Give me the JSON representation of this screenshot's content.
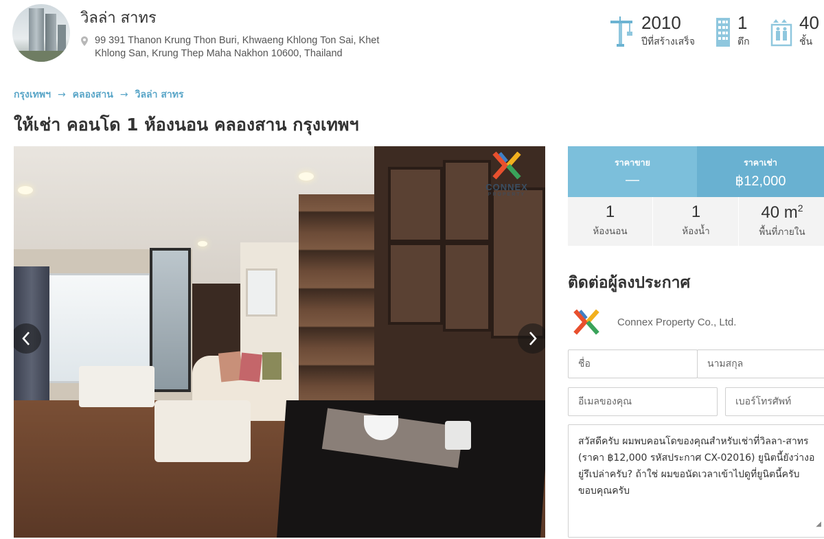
{
  "project": {
    "name": "วิลล่า สาทร",
    "address": "99 391 Thanon Krung Thon Buri, Khwaeng Khlong Ton Sai, Khet Khlong San, Krung Thep Maha Nakhon 10600, Thailand"
  },
  "stats": {
    "year_built": {
      "value": "2010",
      "label": "ปีที่สร้างเสร็จ",
      "icon": "crane-icon"
    },
    "buildings": {
      "value": "1",
      "label": "ตึก",
      "icon": "building-icon"
    },
    "floors": {
      "value": "40",
      "label": "ชั้น",
      "icon": "elevator-icon"
    }
  },
  "breadcrumb": {
    "items": [
      "กรุงเทพฯ",
      "คลองสาน",
      "วิลล่า สาทร"
    ],
    "separator": "→"
  },
  "page_title": "ให้เช่า คอนโด 1 ห้องนอน คลองสาน กรุงเทพฯ",
  "gallery": {
    "watermark_text": "CONNEX",
    "watermark_sub": "PROPERTY",
    "prev_icon": "chevron-left-icon",
    "next_icon": "chevron-right-icon"
  },
  "pricing": {
    "sale_label": "ราคาขาย",
    "sale_value": "—",
    "rent_label": "ราคาเช่า",
    "rent_value": "฿12,000"
  },
  "specs": {
    "bedrooms": {
      "value": "1",
      "label": "ห้องนอน"
    },
    "bathrooms": {
      "value": "1",
      "label": "ห้องน้ำ"
    },
    "area": {
      "value": "40 m",
      "unit_sup": "2",
      "label": "พื้นที่ภายใน"
    }
  },
  "contact": {
    "title": "ติดต่อผู้ลงประกาศ",
    "agent_name": "Connex Property Co., Ltd.",
    "first_name_placeholder": "ชื่อ",
    "last_name_placeholder": "นามสกุล",
    "email_placeholder": "อีเมลของคุณ",
    "phone_placeholder": "เบอร์โทรศัพท์",
    "message": "สวัสดีครับ ผมพบคอนโดของคุณสำหรับเช่าที่วิลลา-สาทร (ราคา ฿12,000 รหัสประกาศ CX-02016) ยูนิตนี้ยังว่างอยู่รึเปล่าครับ? ถ้าใช่ ผมขอนัดเวลาเข้าไปดูที่ยูนิตนี้ครับ ขอบคุณครับ"
  },
  "colors": {
    "accent": "#69b1d1",
    "accent_light": "#7cbfdb",
    "link": "#5aa6c8"
  }
}
